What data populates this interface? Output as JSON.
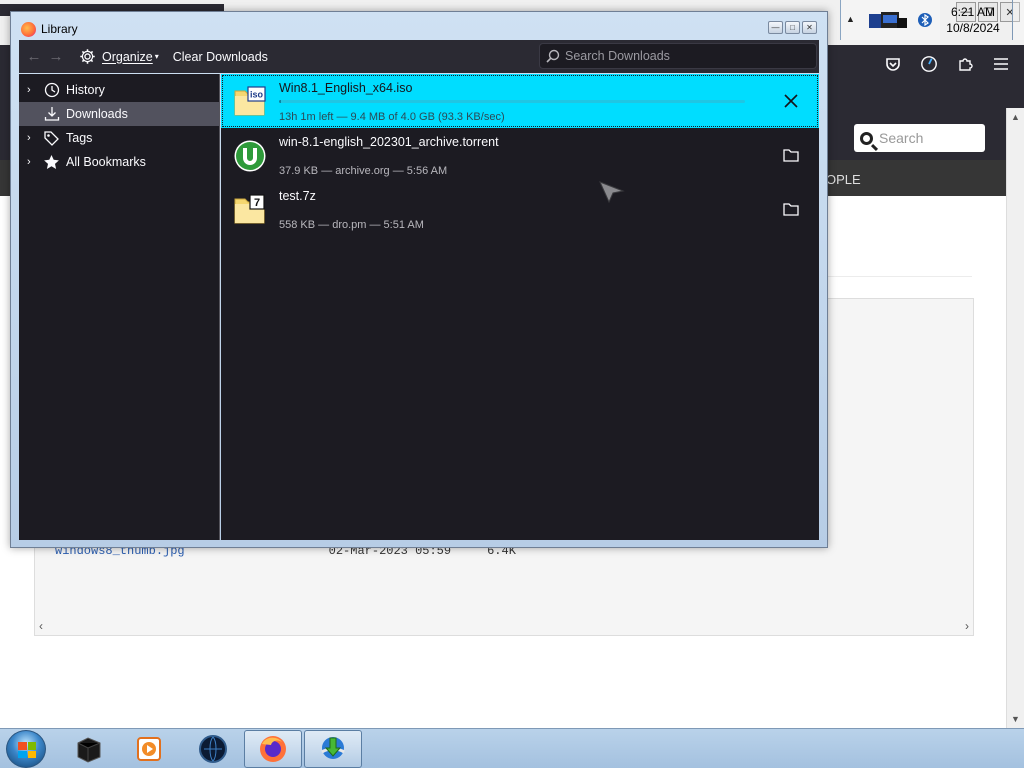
{
  "window": {
    "title": "Library"
  },
  "toolbar": {
    "organize_label": "Organize",
    "clear_downloads_label": "Clear Downloads",
    "search_placeholder": "Search Downloads"
  },
  "sidebar": {
    "items": [
      {
        "label": "History",
        "icon": "clock-icon",
        "expandable": true,
        "selected": false
      },
      {
        "label": "Downloads",
        "icon": "download-icon",
        "expandable": false,
        "selected": true
      },
      {
        "label": "Tags",
        "icon": "tag-icon",
        "expandable": true,
        "selected": false
      },
      {
        "label": "All Bookmarks",
        "icon": "star-icon",
        "expandable": true,
        "selected": false
      }
    ]
  },
  "downloads": [
    {
      "name": "Win8.1_English_x64.iso",
      "status": "13h 1m left — 9.4 MB of 4.0 GB (93.3 KB/sec)",
      "icon": "iso-file-icon",
      "icon_label": "iso",
      "action": "cancel-icon",
      "in_progress": true,
      "progress": 0.0023
    },
    {
      "name": "win-8.1-english_202301_archive.torrent",
      "status": "37.9 KB — archive.org — 5:56 AM",
      "icon": "utorrent-file-icon",
      "action": "folder-icon",
      "in_progress": false
    },
    {
      "name": "test.7z",
      "status": "558 KB — dro.pm — 5:51 AM",
      "icon": "7z-file-icon",
      "icon_label": "7",
      "action": "folder-icon",
      "in_progress": false
    }
  ],
  "background_page": {
    "search_placeholder": "Search",
    "nav_text": "OPLE",
    "list_row": {
      "filename": "windows8_thumb.jpg",
      "date": "02-Mar-2023 05:59",
      "size": "6.4K"
    }
  },
  "taskbar": {
    "time": "6:21 AM",
    "date": "10/8/2024"
  },
  "colors": {
    "selected_row": "#00ddff",
    "panel_bg": "#1c1b22",
    "toolbar_bg": "#2b2a33",
    "sidebar_selected": "#52525e"
  }
}
